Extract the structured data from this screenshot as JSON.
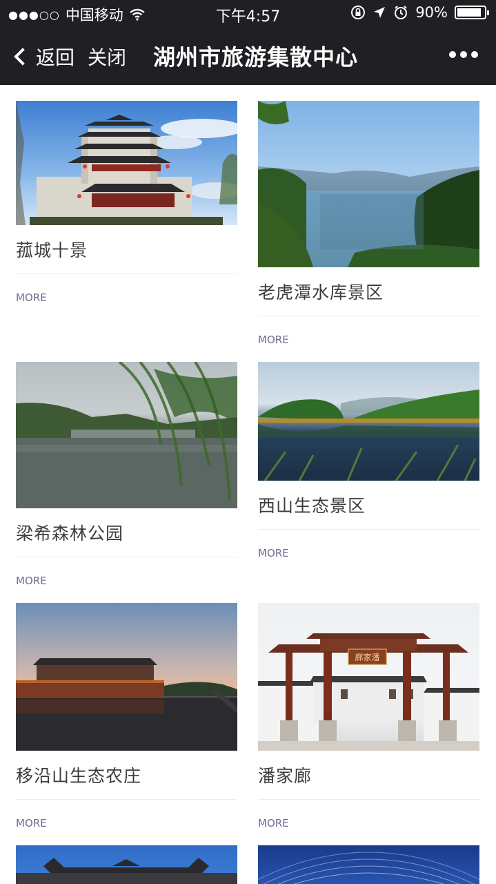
{
  "status": {
    "signal": "●●●○○",
    "carrier": "中国移动",
    "time": "下午4:57",
    "battery": "90%",
    "battery_level": 0.9
  },
  "nav": {
    "back_label": "返回",
    "close_label": "关闭",
    "title": "湖州市旅游集散中心"
  },
  "cards": [
    {
      "title": "菰城十景",
      "more": "MORE"
    },
    {
      "title": "老虎潭水库景区",
      "more": "MORE"
    },
    {
      "title": "梁希森林公园",
      "more": "MORE"
    },
    {
      "title": "西山生态景区",
      "more": "MORE"
    },
    {
      "title": "移沿山生态农庄",
      "more": "MORE"
    },
    {
      "title": "潘家廊",
      "more": "MORE"
    }
  ],
  "gate_sign": "廊家潘"
}
